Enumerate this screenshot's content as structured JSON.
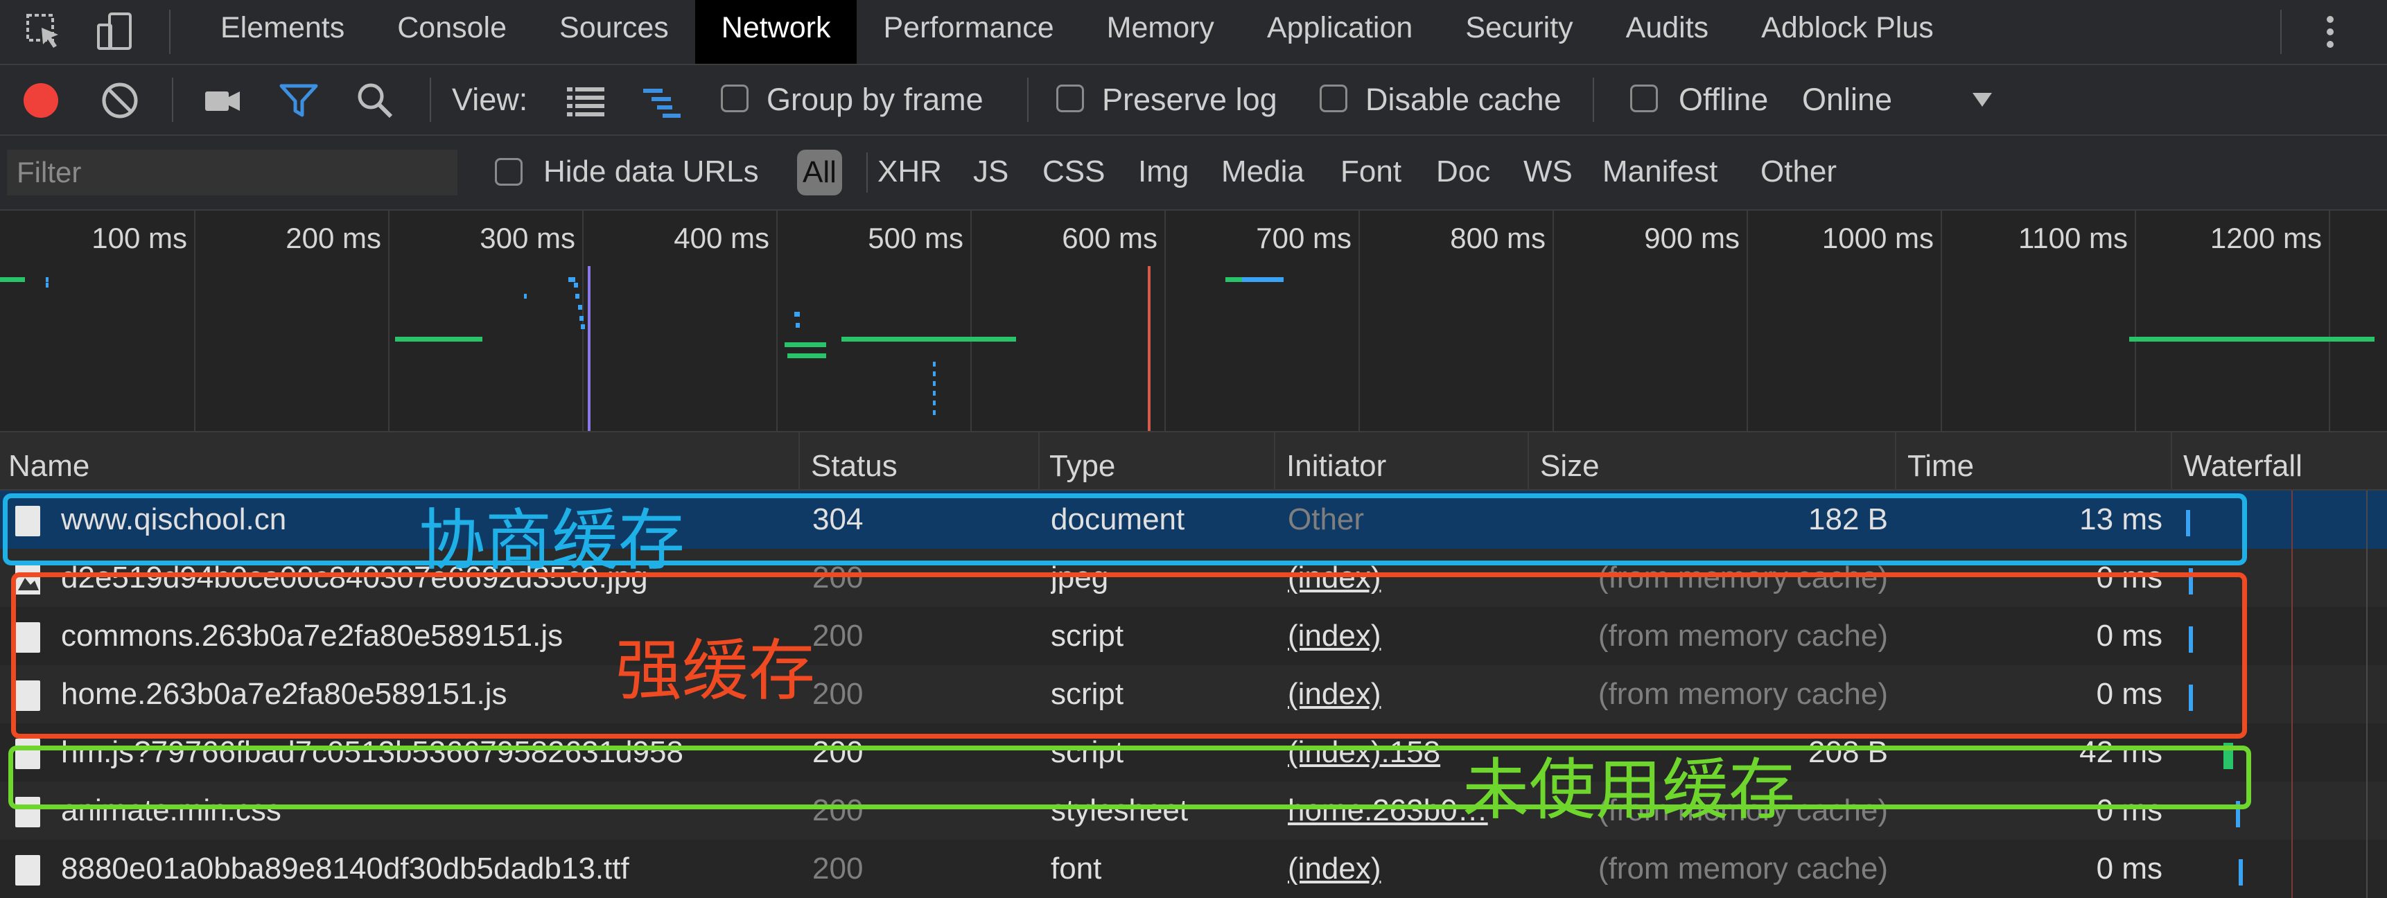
{
  "tabs": [
    "Elements",
    "Console",
    "Sources",
    "Network",
    "Performance",
    "Memory",
    "Application",
    "Security",
    "Audits",
    "Adblock Plus"
  ],
  "active_tab": "Network",
  "toolbar": {
    "view_label": "View:",
    "group_by_frame": "Group by frame",
    "preserve_log": "Preserve log",
    "disable_cache": "Disable cache",
    "offline": "Offline",
    "throttle_value": "Online"
  },
  "filter": {
    "placeholder": "Filter",
    "hide_data_urls": "Hide data URLs",
    "types": [
      "All",
      "XHR",
      "JS",
      "CSS",
      "Img",
      "Media",
      "Font",
      "Doc",
      "WS",
      "Manifest",
      "Other"
    ],
    "active_type": "All"
  },
  "overview": {
    "ticks": [
      "100 ms",
      "200 ms",
      "300 ms",
      "400 ms",
      "500 ms",
      "600 ms",
      "700 ms",
      "800 ms",
      "900 ms",
      "1000 ms",
      "1100 ms",
      "1200 ms"
    ]
  },
  "columns": [
    "Name",
    "Status",
    "Type",
    "Initiator",
    "Size",
    "Time",
    "Waterfall"
  ],
  "rows": [
    {
      "name": "www.qischool.cn",
      "status": "304",
      "type": "document",
      "initiator": "Other",
      "size": "182 B",
      "time": "13 ms",
      "selected": true,
      "dim_status": false,
      "dim_initiator": true,
      "link_initiator": false,
      "icon": "document-icon"
    },
    {
      "name": "d2e519d94b0ce00c840307e6692d35c0.jpg",
      "status": "200",
      "type": "jpeg",
      "initiator": "(index)",
      "size": "(from memory cache)",
      "time": "0 ms",
      "selected": false,
      "dim_status": true,
      "dim_initiator": false,
      "link_initiator": true,
      "icon": "image-icon"
    },
    {
      "name": "commons.263b0a7e2fa80e589151.js",
      "status": "200",
      "type": "script",
      "initiator": "(index)",
      "size": "(from memory cache)",
      "time": "0 ms",
      "selected": false,
      "dim_status": true,
      "dim_initiator": false,
      "link_initiator": true,
      "icon": "file-icon"
    },
    {
      "name": "home.263b0a7e2fa80e589151.js",
      "status": "200",
      "type": "script",
      "initiator": "(index)",
      "size": "(from memory cache)",
      "time": "0 ms",
      "selected": false,
      "dim_status": true,
      "dim_initiator": false,
      "link_initiator": true,
      "icon": "file-icon"
    },
    {
      "name": "hm.js?79766fbad7c0513b536679582631d958",
      "status": "200",
      "type": "script",
      "initiator": "(index):158",
      "size": "208 B",
      "time": "42 ms",
      "selected": false,
      "dim_status": false,
      "dim_initiator": false,
      "link_initiator": true,
      "icon": "file-icon"
    },
    {
      "name": "animate.min.css",
      "status": "200",
      "type": "stylesheet",
      "initiator": "home.263b0…",
      "size": "(from memory cache)",
      "time": "0 ms",
      "selected": false,
      "dim_status": true,
      "dim_initiator": false,
      "link_initiator": true,
      "icon": "file-icon"
    },
    {
      "name": "8880e01a0bba89e8140df30db5dadb13.ttf",
      "status": "200",
      "type": "font",
      "initiator": "(index)",
      "size": "(from memory cache)",
      "time": "0 ms",
      "selected": false,
      "dim_status": true,
      "dim_initiator": false,
      "link_initiator": true,
      "icon": "file-icon"
    }
  ],
  "annotations": [
    {
      "label": "协商缓存",
      "color": "#1fb0e8"
    },
    {
      "label": "强缓存",
      "color": "#f04a23"
    },
    {
      "label": "未使用缓存",
      "color": "#6fd62e"
    }
  ],
  "colors": {
    "selected_row": "#0f3a66",
    "record_red": "#f0403a",
    "filter_blue": "#3d8fe0",
    "waterfall_blue": "#3aa3f4",
    "bar_green": "#29c46a",
    "dom_line_purple": "#8a77e8",
    "load_line_red": "#d45a4a"
  }
}
